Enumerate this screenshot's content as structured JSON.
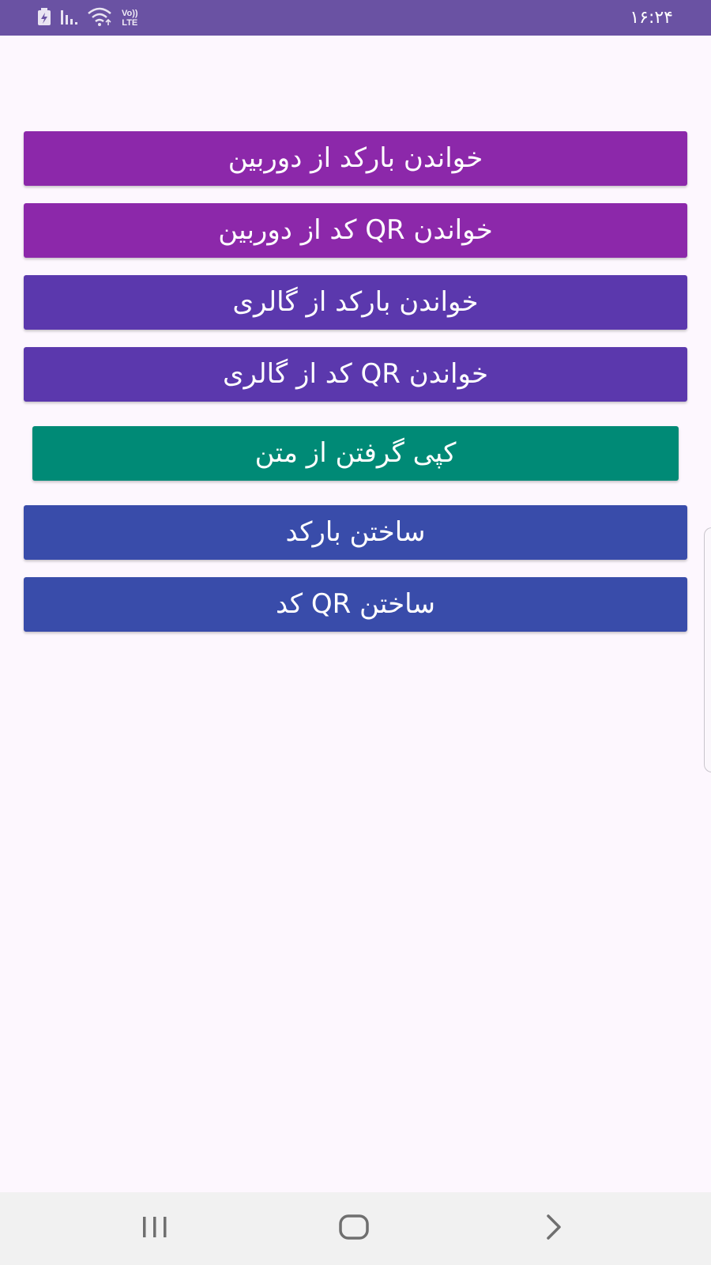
{
  "status_bar": {
    "time": "۱۶:۲۴",
    "network_label_top": "Vo))",
    "network_label_bottom": "LTE",
    "icons": [
      "battery-saver-icon",
      "signal-icon",
      "wifi-icon",
      "volte-icon"
    ],
    "background_color": "#6a52a3"
  },
  "buttons": [
    {
      "label": "خواندن بارکد از دوربین",
      "color": "#8c28aa"
    },
    {
      "label": "خواندن QR کد از دوربین",
      "color": "#8c28aa"
    },
    {
      "label": "خواندن بارکد از گالری",
      "color": "#5b38ad"
    },
    {
      "label": "خواندن QR کد از گالری",
      "color": "#5b38ad"
    },
    {
      "label": "کپی گرفتن از متن",
      "color": "#008a76"
    },
    {
      "label": "ساختن بارکد",
      "color": "#394caa"
    },
    {
      "label": "ساختن QR کد",
      "color": "#394caa"
    }
  ],
  "nav_bar": {
    "icons": [
      "recent-apps-icon",
      "home-icon",
      "back-icon"
    ]
  }
}
